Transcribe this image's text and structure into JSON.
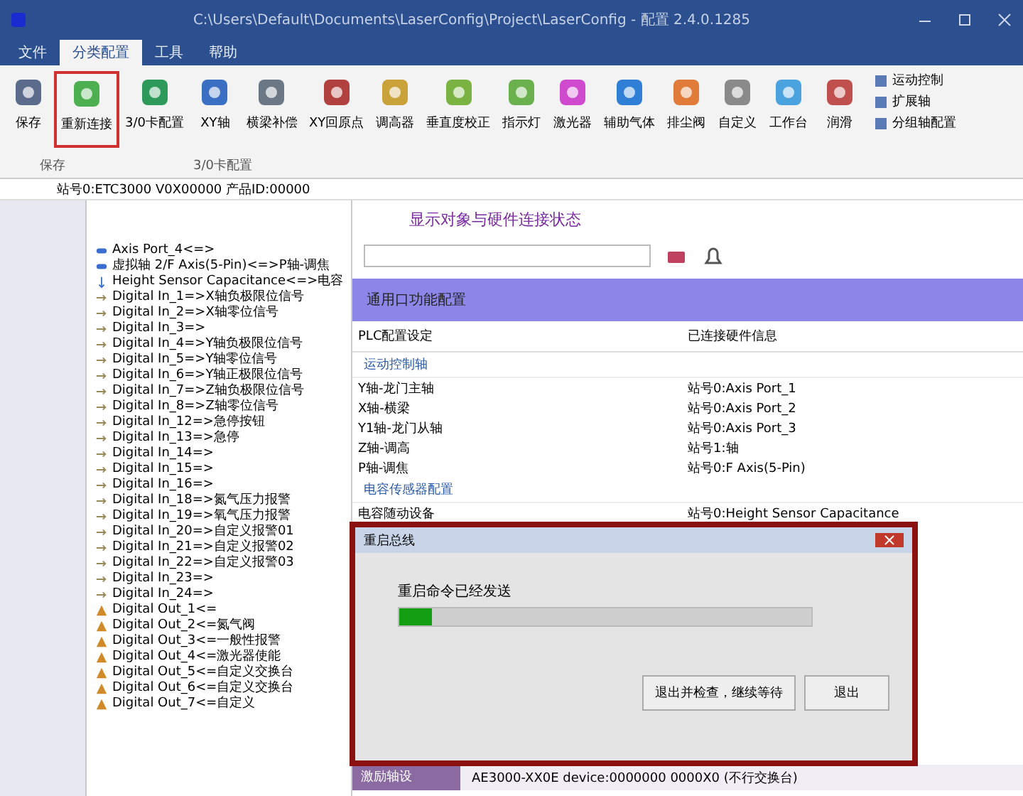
{
  "window": {
    "title": "C:\\Users\\Default\\Documents\\LaserConfig\\Project\\LaserConfig - 配置 2.4.0.1285"
  },
  "menu_tabs": [
    {
      "label": "文件",
      "selected": false
    },
    {
      "label": "分类配置",
      "selected": true
    },
    {
      "label": "工具",
      "selected": false
    },
    {
      "label": "帮助",
      "selected": false
    }
  ],
  "ribbon": {
    "buttons": [
      {
        "label": "保存",
        "selected": false
      },
      {
        "label": "重新连接",
        "selected": true
      },
      {
        "label": "3/0卡配置",
        "selected": false
      },
      {
        "label": "XY轴",
        "selected": false
      },
      {
        "label": "横梁补偿",
        "selected": false
      },
      {
        "label": "XY回原点",
        "selected": false
      },
      {
        "label": "调高器",
        "selected": false
      },
      {
        "label": "垂直度校正",
        "selected": false
      },
      {
        "label": "指示灯",
        "selected": false
      },
      {
        "label": "激光器",
        "selected": false
      },
      {
        "label": "辅助气体",
        "selected": false
      },
      {
        "label": "排尘阀",
        "selected": false
      },
      {
        "label": "自定义",
        "selected": false
      },
      {
        "label": "工作台",
        "selected": false
      },
      {
        "label": "润滑",
        "selected": false
      }
    ],
    "small_buttons": [
      "运动控制",
      "扩展轴",
      "分组轴配置"
    ],
    "groups": [
      "保存",
      "3/0卡配置"
    ]
  },
  "tree": {
    "root": "站号0:ETC3000 V0X00000 产品ID:00000",
    "items": [
      {
        "kind": "axis",
        "label": "Axis Port_4<=>"
      },
      {
        "kind": "axis",
        "label": "虚拟轴 2/F Axis(5-Pin)<=>P轴-调焦"
      },
      {
        "kind": "sensor",
        "label": "Height Sensor Capacitance<=>电容"
      },
      {
        "kind": "input",
        "label": "Digital In_1=>X轴负极限位信号"
      },
      {
        "kind": "input",
        "label": "Digital In_2=>X轴零位信号"
      },
      {
        "kind": "input",
        "label": "Digital In_3=>"
      },
      {
        "kind": "input",
        "label": "Digital In_4=>Y轴负极限位信号"
      },
      {
        "kind": "input",
        "label": "Digital In_5=>Y轴零位信号"
      },
      {
        "kind": "input",
        "label": "Digital In_6=>Y轴正极限位信号"
      },
      {
        "kind": "input",
        "label": "Digital In_7=>Z轴负极限位信号"
      },
      {
        "kind": "input",
        "label": "Digital In_8=>Z轴零位信号"
      },
      {
        "kind": "input",
        "label": "Digital In_12=>急停按钮"
      },
      {
        "kind": "input",
        "label": "Digital In_13=>急停"
      },
      {
        "kind": "input",
        "label": "Digital In_14=>"
      },
      {
        "kind": "input",
        "label": "Digital In_15=>"
      },
      {
        "kind": "input",
        "label": "Digital In_16=>"
      },
      {
        "kind": "input",
        "label": "Digital In_18=>氮气压力报警"
      },
      {
        "kind": "input",
        "label": "Digital In_19=>氧气压力报警"
      },
      {
        "kind": "input",
        "label": "Digital In_20=>自定义报警01"
      },
      {
        "kind": "input",
        "label": "Digital In_21=>自定义报警02"
      },
      {
        "kind": "input",
        "label": "Digital In_22=>自定义报警03"
      },
      {
        "kind": "input",
        "label": "Digital In_23=>"
      },
      {
        "kind": "input",
        "label": "Digital In_24=>"
      },
      {
        "kind": "output",
        "label": "Digital Out_1<="
      },
      {
        "kind": "output",
        "label": "Digital Out_2<=氮气阀"
      },
      {
        "kind": "output",
        "label": "Digital Out_3<=一般性报警"
      },
      {
        "kind": "output",
        "label": "Digital Out_4<=激光器使能"
      },
      {
        "kind": "output",
        "label": "Digital Out_5<=自定义交换台"
      },
      {
        "kind": "output",
        "label": "Digital Out_6<=自定义交换台"
      },
      {
        "kind": "output",
        "label": "Digital Out_7<=自定义"
      }
    ]
  },
  "panel": {
    "heading": "显示对象与硬件连接状态",
    "section": "通用口功能配置",
    "columns": [
      "PLC配置设定",
      "已连接硬件信息"
    ],
    "groups": [
      {
        "title": "运动控制轴",
        "rows": [
          [
            "Y轴-龙门主轴",
            "站号0:Axis Port_1"
          ],
          [
            "X轴-横梁",
            "站号0:Axis Port_2"
          ],
          [
            "Y1轴-龙门从轴",
            "站号0:Axis Port_3"
          ],
          [
            "Z轴-调高",
            "站号1:轴"
          ],
          [
            "P轴-调焦",
            "站号0:F Axis(5-Pin)"
          ]
        ]
      },
      {
        "title": "电容传感器配置",
        "rows": [
          [
            "电容随动设备",
            "站号0:Height Sensor Capacitance"
          ]
        ]
      }
    ]
  },
  "status": {
    "label": "激励轴设",
    "value": "AE3000-XX0E device:0000000 0000X0 (不行交换台)"
  },
  "dialog": {
    "title": "重启总线",
    "message": "重启命令已经发送",
    "level": 0.08,
    "buttons": [
      "退出并检查，继续等待",
      "退出"
    ]
  }
}
